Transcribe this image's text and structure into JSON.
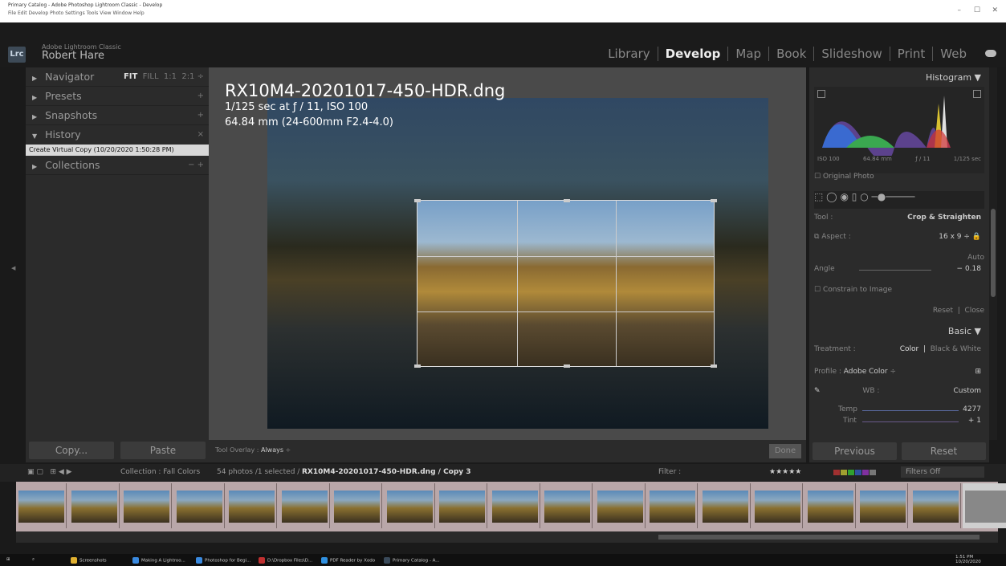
{
  "window": {
    "title": "Primary Catalog - Adobe Photoshop Lightroom Classic - Develop",
    "menu": "File  Edit  Develop  Photo  Settings  Tools  View  Window  Help",
    "min_icon": "–",
    "max_icon": "☐",
    "close_icon": "✕"
  },
  "app": {
    "logo": "Lrc",
    "name": "Adobe Lightroom Classic",
    "user": "Robert Hare"
  },
  "modules": [
    "Library",
    "Develop",
    "Map",
    "Book",
    "Slideshow",
    "Print",
    "Web"
  ],
  "active_module": "Develop",
  "left_panel": {
    "navigator": {
      "label": "Navigator",
      "options": [
        "FIT",
        "FILL",
        "1:1",
        "2:1",
        "÷"
      ]
    },
    "presets": {
      "label": "Presets",
      "icon": "+"
    },
    "snapshots": {
      "label": "Snapshots",
      "icon": "+"
    },
    "history": {
      "label": "History",
      "icon": "×"
    },
    "history_items": [
      "Create Virtual Copy (10/20/2020 1:50:28 PM)"
    ],
    "collections": {
      "label": "Collections",
      "icon": "− +"
    },
    "copy_btn": "Copy...",
    "paste_btn": "Paste"
  },
  "photo": {
    "filename": "RX10M4-20201017-450-HDR.dng",
    "exposure": "1/125 sec at ƒ / 11, ISO 100",
    "lens": "64.84 mm (24-600mm F2.4-4.0)"
  },
  "toolbar": {
    "overlay_label": "Tool Overlay :",
    "overlay_value": "Always",
    "done": "Done"
  },
  "right_panel": {
    "histogram": "Histogram",
    "histo_meta": [
      "ISO 100",
      "64.84 mm",
      "ƒ / 11",
      "1/125 sec"
    ],
    "original_photo": "Original Photo",
    "tool_label": "Tool :",
    "tool_value": "Crop & Straighten",
    "aspect_label": "Aspect :",
    "aspect_value": "16 x 9",
    "auto": "Auto",
    "angle_label": "Angle",
    "angle_value": "− 0.18",
    "constrain": "Constrain to Image",
    "reset": "Reset",
    "close": "Close",
    "basic": "Basic",
    "treatment_label": "Treatment :",
    "treatment_color": "Color",
    "treatment_bw": "Black & White",
    "profile_label": "Profile :",
    "profile_value": "Adobe Color",
    "wb_label": "WB :",
    "wb_value": "Custom",
    "temp_label": "Temp",
    "temp_value": "4277",
    "tint_label": "Tint",
    "tint_value": "+ 1",
    "previous_btn": "Previous",
    "reset_btn": "Reset"
  },
  "filmbar": {
    "collection": "Collection : Fall Colors",
    "count": "54 photos /1 selected /",
    "current_file": "RX10M4-20201017-450-HDR.dng / Copy 3",
    "filter_label": "Filter :",
    "filters_off": "Filters Off"
  },
  "taskbar": {
    "items": [
      "Screenshots",
      "Making A Lightroo...",
      "Photoshop for Begi...",
      "D:\\Dropbox Files\\D...",
      "PDF Reader by Xodo",
      "Primary Catalog - A..."
    ],
    "time": "1:51 PM",
    "date": "10/20/2020"
  }
}
